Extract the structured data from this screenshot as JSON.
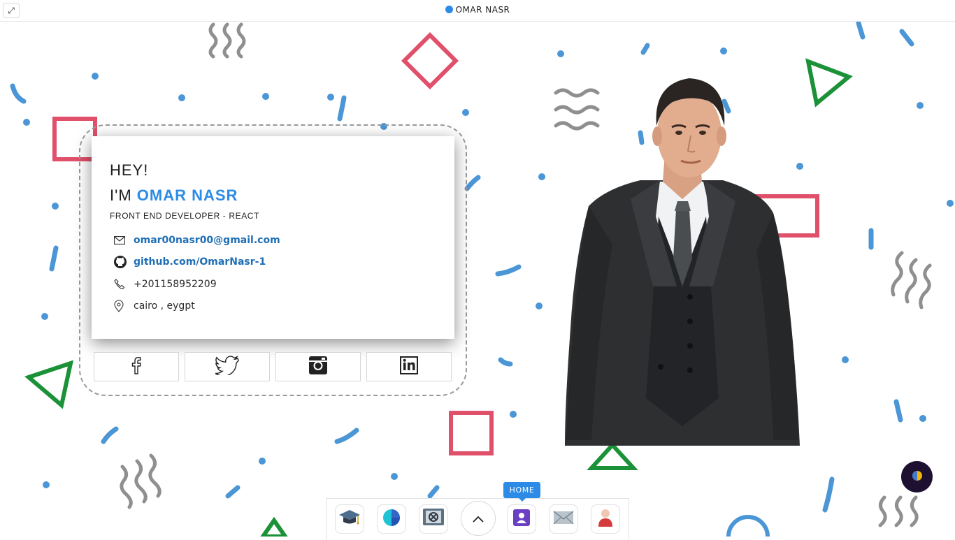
{
  "topbar": {
    "expand_icon": "expand-icon",
    "title": "OMAR NASR",
    "dot_color": "#2b8be6"
  },
  "profile": {
    "greeting": "HEY!",
    "intro_prefix": "I'M",
    "name": "OMAR NASR",
    "role": "FRONT END DEVELOPER - REACT",
    "email": "omar00nasr00@gmail.com",
    "github": "github.com/OmarNasr-1",
    "phone": "+201158952209",
    "location": "cairo , eygpt",
    "accent_color": "#2b8be6",
    "link_color": "#1f6fb5"
  },
  "socials": [
    {
      "name": "facebook",
      "icon": "facebook-icon"
    },
    {
      "name": "twitter",
      "icon": "twitter-icon"
    },
    {
      "name": "instagram",
      "icon": "instagram-icon"
    },
    {
      "name": "linkedin",
      "icon": "linkedin-icon"
    }
  ],
  "dock": {
    "tooltip": "HOME",
    "items": [
      "education-icon",
      "skills-icon",
      "portfolio-icon",
      "scroll-up-icon",
      "home-icon",
      "contact-icon",
      "about-icon"
    ]
  },
  "theme_toggle": {
    "icon": "theme-toggle-icon"
  }
}
